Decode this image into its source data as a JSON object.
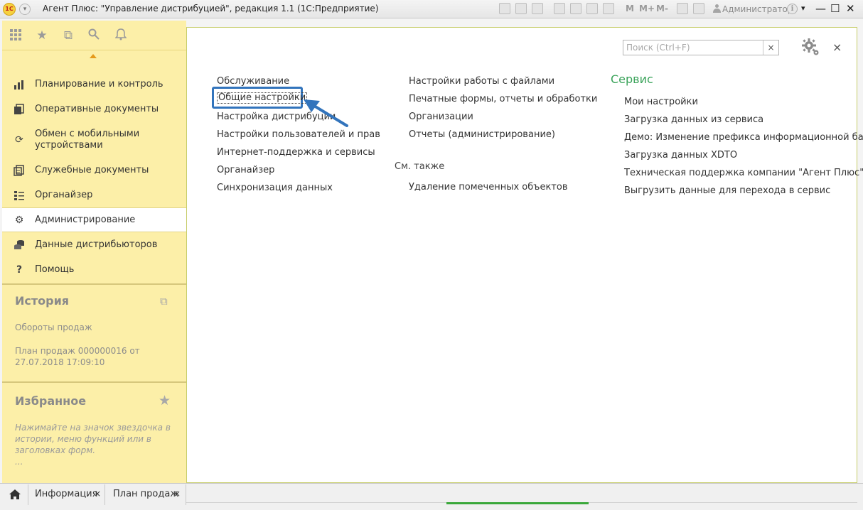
{
  "window": {
    "title": "Агент Плюс: \"Управление дистрибуцией\", редакция 1.1  (1С:Предприятие)",
    "logo_text": "1С",
    "user": "Администратор",
    "toolbar_text": [
      "M",
      "M+",
      "M-"
    ]
  },
  "sidebar": {
    "items": [
      {
        "label": "Планирование и контроль",
        "icon": "chart-icon"
      },
      {
        "label": "Оперативные документы",
        "icon": "documents-icon"
      },
      {
        "label": "Обмен с мобильными устройствами",
        "icon": "sync-icon"
      },
      {
        "label": "Служебные документы",
        "icon": "service-documents-icon"
      },
      {
        "label": "Органайзер",
        "icon": "organizer-icon"
      },
      {
        "label": "Администрирование",
        "icon": "gear-icon",
        "active": true
      },
      {
        "label": "Данные дистрибьюторов",
        "icon": "distributors-icon"
      },
      {
        "label": "Помощь",
        "icon": "question-icon"
      }
    ],
    "history": {
      "title": "История",
      "items": [
        "Обороты продаж",
        "План продаж 000000016 от 27.07.2018 17:09:10"
      ]
    },
    "favorites": {
      "title": "Избранное",
      "hint": "Нажимайте на значок звездочка в истории, меню функций или в заголовках форм.",
      "ellipsis": "..."
    }
  },
  "main": {
    "search_placeholder": "Поиск (Ctrl+F)",
    "search_clear": "×",
    "close": "×",
    "col1": [
      "Обслуживание",
      "Общие настройки",
      "Настройка дистрибуции",
      "Настройки пользователей и прав",
      "Интернет-поддержка и сервисы",
      "Органайзер",
      "Синхронизация данных"
    ],
    "col2": [
      "Настройки работы с файлами",
      "Печатные формы, отчеты и обработки",
      "Организации",
      "Отчеты (администрирование)"
    ],
    "see_also_title": "См. также",
    "see_also": [
      "Удаление помеченных объектов"
    ],
    "service_title": "Сервис",
    "service": [
      "Мои настройки",
      "Загрузка данных из сервиса",
      "Демо: Изменение префикса информационной базы",
      "Загрузка данных XDTO",
      "Техническая поддержка компании \"Агент Плюс\"",
      "Выгрузить данные для перехода в сервис"
    ],
    "accent_color": "#3aa35a",
    "highlight_color": "#3274bc"
  },
  "tabs": [
    {
      "label": "Информация",
      "close": "×"
    },
    {
      "label": "План продаж",
      "close": "×"
    }
  ]
}
